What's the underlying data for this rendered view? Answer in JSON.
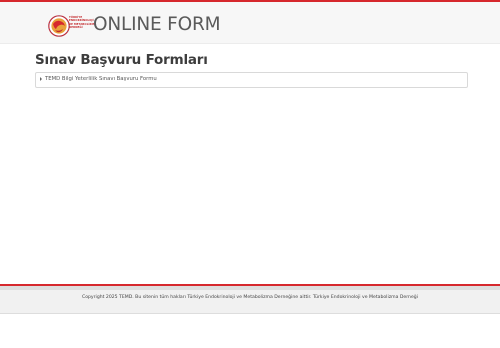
{
  "header": {
    "logo_lines": [
      "TÜRKİYE",
      "ENDOKRİNOLOJİ",
      "VE METABOLİZMA",
      "DERNEĞİ"
    ],
    "brand": "ONLINE FORM",
    "accent_color": "#d6282d"
  },
  "main": {
    "title": "Sınav Başvuru Formları",
    "forms": [
      {
        "label": "TEMD Bilgi Yeterlilik Sınavı Başvuru Formu",
        "icon": "caret-right-icon"
      }
    ]
  },
  "footer": {
    "copyright": "Copyright 2025 TEMD. Bu sitenin tüm hakları Türkiye Endokrinoloji ve Metabolizma Derneğine aittir. Türkiye Endokrinoloji ve Metabolizma Derneği"
  }
}
